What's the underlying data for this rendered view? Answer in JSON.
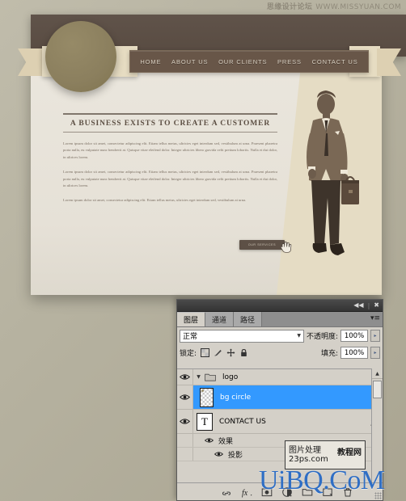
{
  "watermarks": {
    "top_cn": "思缘设计论坛",
    "top_url": "WWW.MISSYUAN.COM",
    "box_line1": "图片处理",
    "box_line2": "23ps.com",
    "box_right": "教程网",
    "uibq": "UiBQ.CoM"
  },
  "mockup": {
    "nav": {
      "items": [
        {
          "label": "HOME"
        },
        {
          "label": "ABOUT US"
        },
        {
          "label": "OUR CLIENTS"
        },
        {
          "label": "PRESS"
        },
        {
          "label": "CONTACT US"
        }
      ]
    },
    "headline": "A BUSINESS EXISTS TO CREATE A CUSTOMER",
    "paragraphs": [
      "Lorem ipsum dolor sit amet, consectetur adipiscing elit. Etiam tellus metus, ultricies eget interdum sed, vestibulum at urna. Praesent pharetra porta nulla, eu vulputate nunc hendrerit at. Quisque vitae eleifend dolor. Integer ultricies libero gravida velit pretium lobortis. Nulla et dui dolor, in ultrices lorem.",
      "Lorem ipsum dolor sit amet, consectetur adipiscing elit. Etiam tellus metus, ultricies eget interdum sed, vestibulum at urna. Praesent pharetra porta nulla, eu vulputate nunc hendrerit at. Quisque vitae eleifend dolor. Integer ultricies libero gravida velit pretium lobortis. Nulla et dui dolor, in ultrices lorem.",
      "Lorem ipsum dolor sit amet, consectetur adipiscing elit. Etiam tellus metus, ultricies eget interdum sed, vestibulum at urna."
    ],
    "cta_label": "OUR SERVICES",
    "colors": {
      "header_brown": "#5b4e43",
      "nav_brown": "#685648",
      "ribbon_cream": "#e6dcc2",
      "logo_olive": "#8b7f5e",
      "sheet": "#e9e5dc",
      "page_bg": "#b6b2a0"
    }
  },
  "ps_panel": {
    "titlebar": {
      "collapse_label": "◀◀",
      "separator": "|",
      "close_label": "✖"
    },
    "tabs": [
      {
        "label": "图层",
        "active": true
      },
      {
        "label": "通道",
        "active": false
      },
      {
        "label": "路径",
        "active": false
      }
    ],
    "menu_label": "▾≡",
    "blend_mode": {
      "value": "正常",
      "arrow": "▼"
    },
    "opacity": {
      "label": "不透明度:",
      "value": "100%",
      "spin": "▸"
    },
    "lock": {
      "label": "锁定:",
      "icons": [
        "lock-transparent-icon",
        "lock-image-icon",
        "lock-position-icon",
        "lock-all-icon"
      ]
    },
    "fill": {
      "label": "填充:",
      "value": "100%",
      "spin": "▸"
    },
    "layers": [
      {
        "name": "logo",
        "type": "group",
        "visible": true,
        "expanded": true,
        "selected": false,
        "twisty": "▼"
      },
      {
        "name": "bg circle",
        "type": "pixel",
        "visible": true,
        "selected": true
      },
      {
        "name": "CONTACT US",
        "type": "text",
        "thumb_glyph": "T",
        "visible": true,
        "selected": false,
        "has_effects": true,
        "fx_label": "fx"
      }
    ],
    "effects": {
      "group_label": "效果",
      "items": [
        {
          "label": "投影"
        }
      ]
    },
    "scrollbar": {
      "up_arrow": "▲",
      "down_arrow": "▼"
    },
    "bottom_tools": [
      "link-layers-icon",
      "layer-style-fx-icon",
      "add-mask-icon",
      "adjustment-layer-icon",
      "new-group-icon",
      "new-layer-icon",
      "delete-layer-icon"
    ],
    "colors": {
      "panel_bg": "#d4d0c8",
      "selection_blue": "#3399ff",
      "titlebar": "#3a3a3a"
    }
  }
}
